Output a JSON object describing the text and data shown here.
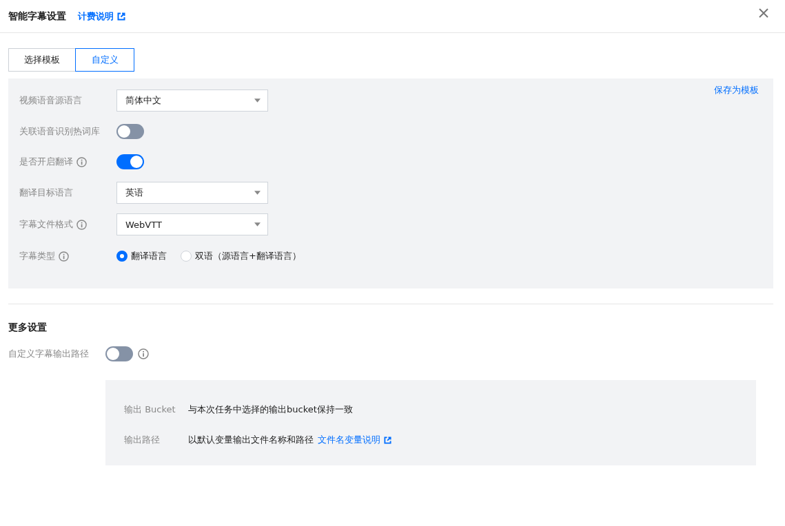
{
  "header": {
    "title": "智能字幕设置",
    "link": "计费说明"
  },
  "tabs": [
    {
      "label": "选择模板",
      "selected": false
    },
    {
      "label": "自定义",
      "selected": true
    }
  ],
  "save_template": "保存为模板",
  "form": [
    {
      "kind": "select",
      "label": "视频语音源语言",
      "info": false,
      "value": "简体中文"
    },
    {
      "kind": "switch",
      "label": "关联语音识别热词库",
      "info": false,
      "on": false
    },
    {
      "kind": "switch",
      "label": "是否开启翻译",
      "info": true,
      "on": true
    },
    {
      "kind": "select",
      "label": "翻译目标语言",
      "info": false,
      "value": "英语"
    },
    {
      "kind": "select",
      "label": "字幕文件格式",
      "info": true,
      "value": "WebVTT"
    },
    {
      "kind": "radio",
      "label": "字幕类型",
      "info": true,
      "options": [
        {
          "label": "翻译语言",
          "selected": true
        },
        {
          "label": "双语（源语言+翻译语言）",
          "selected": false
        }
      ]
    }
  ],
  "more_settings": {
    "title": "更多设置",
    "label": "自定义字幕输出路径",
    "on": false,
    "info": true,
    "details": [
      {
        "label": "输出 Bucket",
        "value": "与本次任务中选择的输出bucket保持一致"
      },
      {
        "label": "输出路径",
        "value": "以默认变量输出文件名称和路径",
        "link": "文件名变量说明"
      }
    ]
  }
}
